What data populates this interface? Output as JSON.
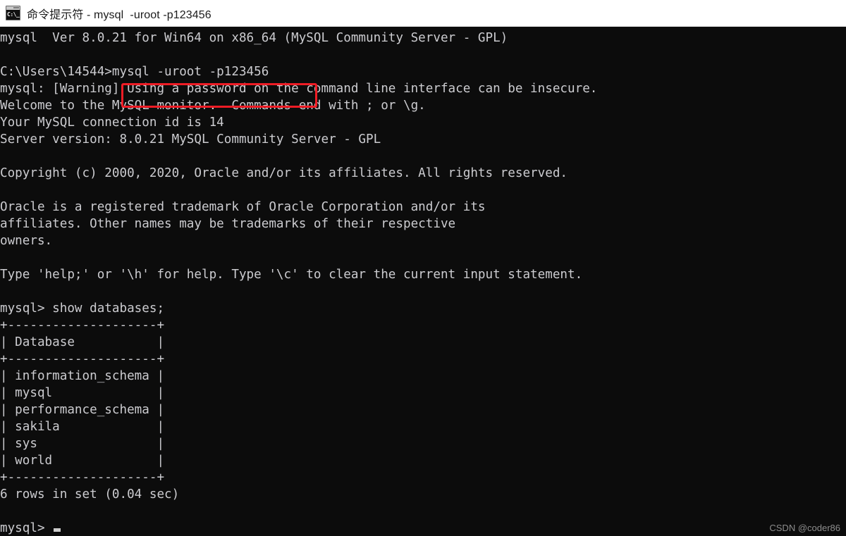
{
  "window": {
    "title": "命令提示符 - mysql  -uroot -p123456",
    "icon_name": "cmd-icon",
    "icon_glyph": "C:\\_",
    "title_bar_bg": "#ffffff",
    "terminal_bg": "#0c0c0c",
    "terminal_fg": "#ccccd0"
  },
  "annotation": {
    "color": "#ee1c25",
    "target_text": "mysql -uroot -p123456"
  },
  "terminal": {
    "lines": [
      "mysql  Ver 8.0.21 for Win64 on x86_64 (MySQL Community Server - GPL)",
      "",
      "C:\\Users\\14544>mysql -uroot -p123456",
      "mysql: [Warning] Using a password on the command line interface can be insecure.",
      "Welcome to the MySQL monitor.  Commands end with ; or \\g.",
      "Your MySQL connection id is 14",
      "Server version: 8.0.21 MySQL Community Server - GPL",
      "",
      "Copyright (c) 2000, 2020, Oracle and/or its affiliates. All rights reserved.",
      "",
      "Oracle is a registered trademark of Oracle Corporation and/or its",
      "affiliates. Other names may be trademarks of their respective",
      "owners.",
      "",
      "Type 'help;' or '\\h' for help. Type '\\c' to clear the current input statement.",
      "",
      "mysql> show databases;",
      "+--------------------+",
      "| Database           |",
      "+--------------------+",
      "| information_schema |",
      "| mysql              |",
      "| performance_schema |",
      "| sakila             |",
      "| sys                |",
      "| world              |",
      "+--------------------+",
      "6 rows in set (0.04 sec)",
      ""
    ],
    "prompt": "mysql>",
    "cursor_visible": true,
    "query": {
      "command": "show databases;",
      "column_header": "Database",
      "rows": [
        "information_schema",
        "mysql",
        "performance_schema",
        "sakila",
        "sys",
        "world"
      ],
      "result_summary": "6 rows in set (0.04 sec)",
      "row_count": 6,
      "elapsed_seconds": "0.04"
    },
    "server_info": {
      "client_version_line": "mysql  Ver 8.0.21 for Win64 on x86_64 (MySQL Community Server - GPL)",
      "connection_id": "14",
      "server_version": "8.0.21 MySQL Community Server - GPL",
      "working_directory_prompt": "C:\\Users\\14544>",
      "command_entered": "mysql -uroot -p123456"
    }
  },
  "watermark": {
    "text": "CSDN @coder86"
  }
}
